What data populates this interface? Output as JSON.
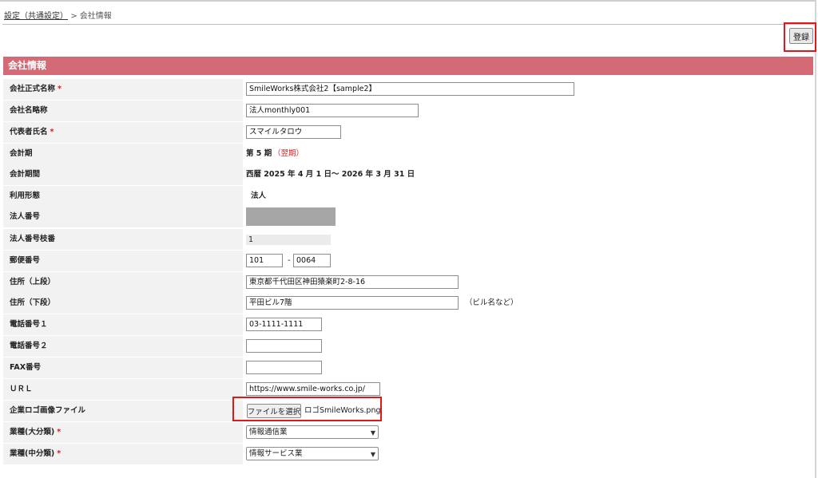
{
  "breadcrumb": {
    "parent": "設定（共通設定）",
    "separator": ">",
    "current": "会社情報"
  },
  "toolbar": {
    "save_label": "登録"
  },
  "section": {
    "title": "会社情報"
  },
  "required_mark": "*",
  "form": {
    "official_name": {
      "label": "会社正式名称",
      "value": "SmileWorks株式会社2【sample2】"
    },
    "short_name": {
      "label": "会社名略称",
      "value": "法人monthly001"
    },
    "representative": {
      "label": "代表者氏名",
      "value": "スマイルタロウ"
    },
    "fiscal_period": {
      "label": "会計期",
      "value": "第 5 期",
      "note": "（翌期）"
    },
    "fiscal_range": {
      "label": "会計期間",
      "value": "西暦 2025 年 4 月 1 日～ 2026 年 3 月 31 日"
    },
    "usage_type": {
      "label": "利用形態",
      "value": "法人"
    },
    "corp_number": {
      "label": "法人番号",
      "value": ""
    },
    "corp_branch": {
      "label": "法人番号枝番",
      "value": "1"
    },
    "postal": {
      "label": "郵便番号",
      "value1": "101",
      "separator": "-",
      "value2": "0064"
    },
    "address1": {
      "label": "住所（上段）",
      "value": "東京都千代田区神田猿楽町2-8-16"
    },
    "address2": {
      "label": "住所（下段）",
      "value": "平田ビル7階",
      "hint": "（ビル名など）"
    },
    "phone1": {
      "label": "電話番号１",
      "value": "03-1111-1111"
    },
    "phone2": {
      "label": "電話番号２",
      "value": ""
    },
    "fax": {
      "label": "FAX番号",
      "value": ""
    },
    "url": {
      "label": "ＵＲＬ",
      "value": "https://www.smile-works.co.jp/"
    },
    "logo": {
      "label": "企業ロゴ画像ファイル",
      "button": "ファイルを選択",
      "file_name": "ロゴSmileWorks.png"
    },
    "industry_major": {
      "label": "業種(大分類)",
      "value": "情報通信業"
    },
    "industry_mid": {
      "label": "業種(中分類)",
      "value": "情報サービス業"
    }
  },
  "colors": {
    "section_header": "#d46a75",
    "required": "#e01818",
    "highlight": "#e01818"
  }
}
